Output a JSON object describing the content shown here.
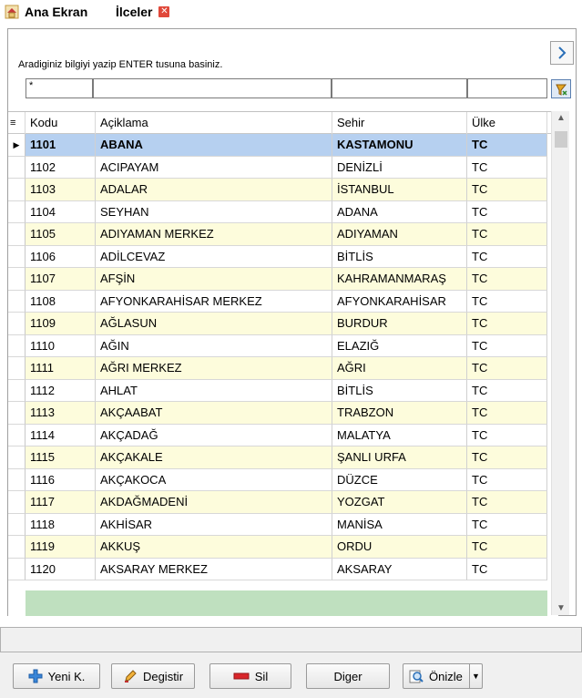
{
  "tabs": [
    {
      "label": "Ana Ekran"
    },
    {
      "label": "İlceler"
    }
  ],
  "search": {
    "hint": "Aradiginiz bilgiyi yazip ENTER tusuna basiniz.",
    "filter_values": [
      "*",
      "",
      "",
      ""
    ]
  },
  "grid": {
    "columns": [
      "Kodu",
      "Açiklama",
      "Sehir",
      "Ülke"
    ],
    "rows": [
      [
        "1101",
        "ABANA",
        "KASTAMONU",
        "TC"
      ],
      [
        "1102",
        "ACIPAYAM",
        "DENİZLİ",
        "TC"
      ],
      [
        "1103",
        "ADALAR",
        "İSTANBUL",
        "TC"
      ],
      [
        "1104",
        "SEYHAN",
        "ADANA",
        "TC"
      ],
      [
        "1105",
        "ADIYAMAN MERKEZ",
        "ADIYAMAN",
        "TC"
      ],
      [
        "1106",
        "ADİLCEVAZ",
        "BİTLİS",
        "TC"
      ],
      [
        "1107",
        "AFŞİN",
        "KAHRAMANMARAŞ",
        "TC"
      ],
      [
        "1108",
        "AFYONKARAHİSAR MERKEZ",
        "AFYONKARAHİSAR",
        "TC"
      ],
      [
        "1109",
        "AĞLASUN",
        "BURDUR",
        "TC"
      ],
      [
        "1110",
        "AĞIN",
        "ELAZIĞ",
        "TC"
      ],
      [
        "1111",
        "AĞRI MERKEZ",
        "AĞRI",
        "TC"
      ],
      [
        "1112",
        "AHLAT",
        "BİTLİS",
        "TC"
      ],
      [
        "1113",
        "AKÇAABAT",
        "TRABZON",
        "TC"
      ],
      [
        "1114",
        "AKÇADAĞ",
        "MALATYA",
        "TC"
      ],
      [
        "1115",
        "AKÇAKALE",
        "ŞANLI URFA",
        "TC"
      ],
      [
        "1116",
        "AKÇAKOCA",
        "DÜZCE",
        "TC"
      ],
      [
        "1117",
        "AKDAĞMADENİ",
        "YOZGAT",
        "TC"
      ],
      [
        "1118",
        "AKHİSAR",
        "MANİSA",
        "TC"
      ],
      [
        "1119",
        "AKKUŞ",
        "ORDU",
        "TC"
      ],
      [
        "1120",
        "AKSARAY MERKEZ",
        "AKSARAY",
        "TC"
      ]
    ]
  },
  "buttons": {
    "new": "Yeni K.",
    "edit": "Degistir",
    "delete": "Sil",
    "other": "Diger",
    "preview": "Önizle"
  },
  "icons": {
    "home": "home-icon",
    "close": "close-icon",
    "next": "chevron-right-icon",
    "clear": "filter-clear-icon",
    "new": "plus-icon",
    "edit": "pencil-icon",
    "delete": "minus-icon",
    "preview": "magnifier-icon"
  },
  "colors": {
    "selected_row": "#b6d0f0",
    "odd_row": "#fdfcdc",
    "footer_band": "#bfe0bf",
    "tab_close": "#e0483a"
  }
}
